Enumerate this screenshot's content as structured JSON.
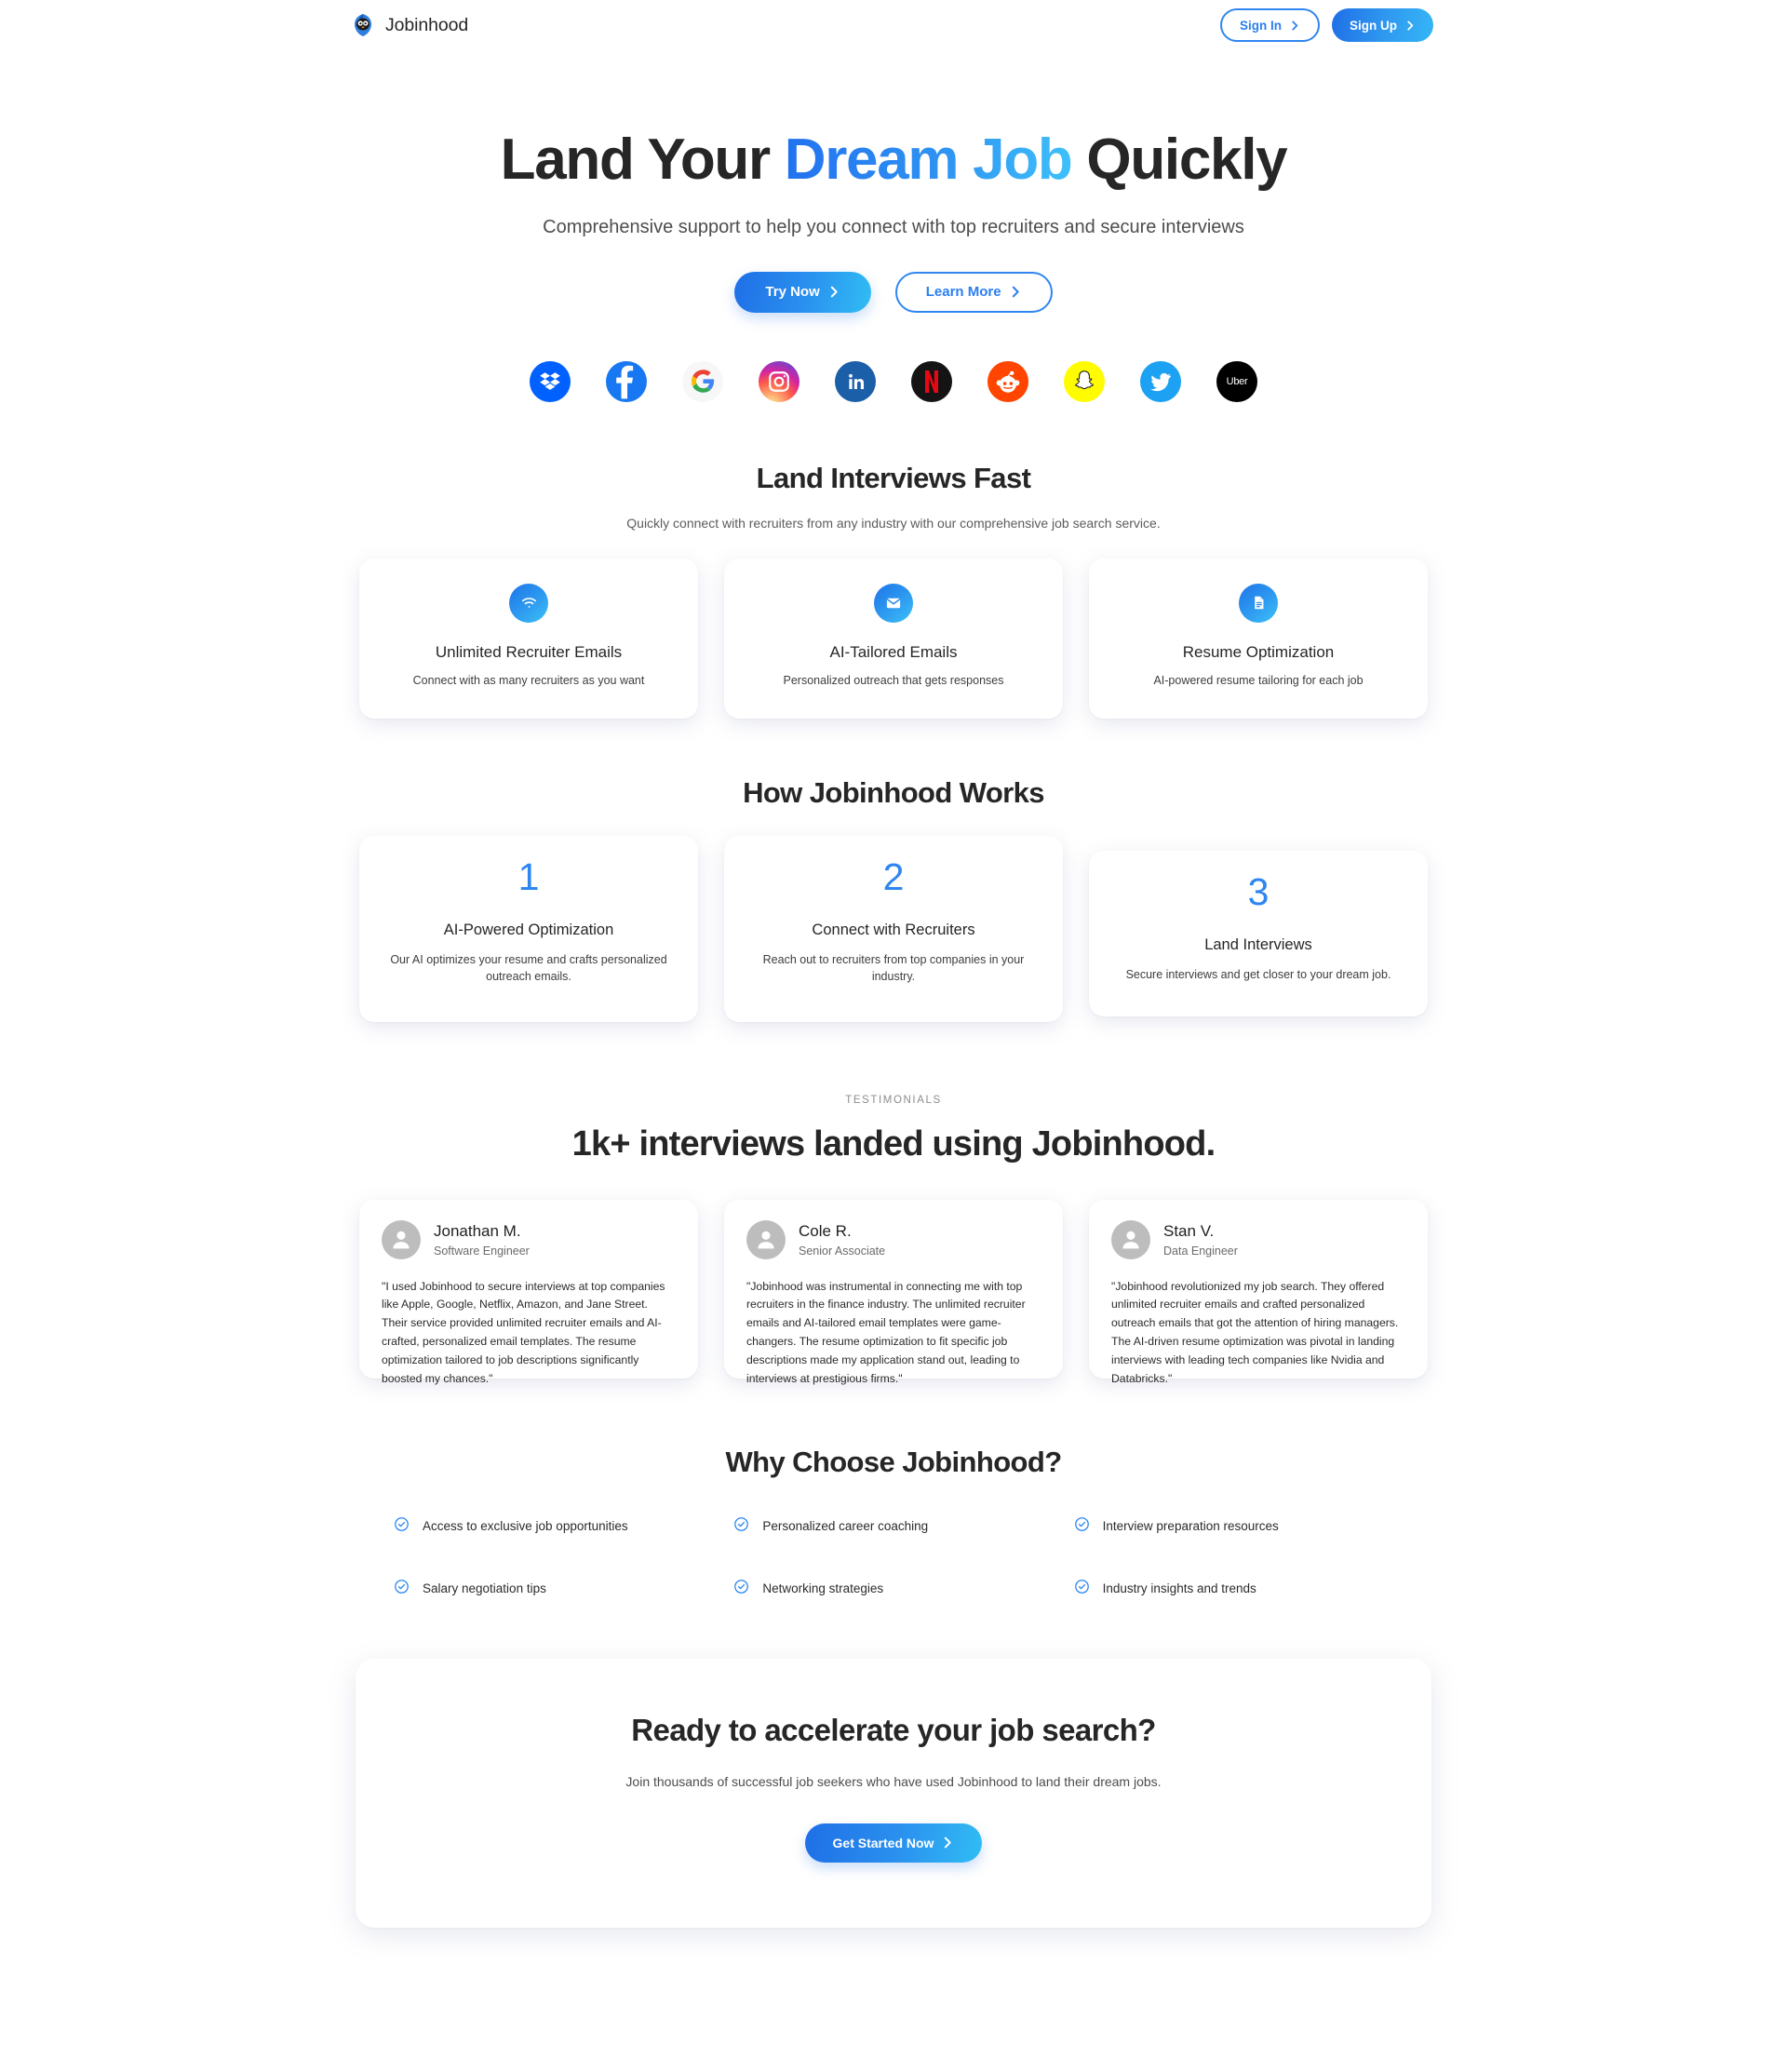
{
  "header": {
    "brand_name": "Jobinhood",
    "brand_logo_icon": "jobinhood-owl-logo",
    "sign_in_label": "Sign In",
    "sign_up_label": "Sign Up"
  },
  "hero": {
    "title_part1": "Land Your ",
    "title_highlight": "Dream Job",
    "title_part2": " Quickly",
    "subtitle": "Comprehensive support to help you connect with top recruiters and secure interviews",
    "primary_cta": "Try Now",
    "secondary_cta": "Learn More"
  },
  "logos": [
    {
      "name": "dropbox",
      "label": "Dropbox",
      "bg": "#0061FF"
    },
    {
      "name": "facebook",
      "label": "Facebook",
      "bg": "#1877F2"
    },
    {
      "name": "google",
      "label": "Google",
      "bg": "#F7F7F7"
    },
    {
      "name": "instagram",
      "label": "Instagram",
      "bg": "#E1306C"
    },
    {
      "name": "linkedin",
      "label": "LinkedIn",
      "bg": "#1A5FA8"
    },
    {
      "name": "netflix",
      "label": "Netflix",
      "bg": "#141414"
    },
    {
      "name": "reddit",
      "label": "Reddit",
      "bg": "#FF4500"
    },
    {
      "name": "snapchat",
      "label": "Snapchat",
      "bg": "#FFFC00"
    },
    {
      "name": "twitter",
      "label": "Twitter",
      "bg": "#1DA1F2"
    },
    {
      "name": "uber",
      "label": "Uber",
      "bg": "#000000"
    }
  ],
  "features_section": {
    "title": "Land Interviews Fast",
    "subtitle": "Quickly connect with recruiters from any industry with our comprehensive job search service.",
    "cards": [
      {
        "icon": "wifi-signal-icon",
        "title": "Unlimited Recruiter Emails",
        "desc": "Connect with as many recruiters as you want"
      },
      {
        "icon": "envelope-icon",
        "title": "AI-Tailored Emails",
        "desc": "Personalized outreach that gets responses"
      },
      {
        "icon": "document-icon",
        "title": "Resume Optimization",
        "desc": "AI-powered resume tailoring for each job"
      }
    ]
  },
  "how_section": {
    "title": "How Jobinhood Works",
    "steps": [
      {
        "number": "1",
        "title": "AI-Powered Optimization",
        "desc": "Our AI optimizes your resume and crafts personalized outreach emails."
      },
      {
        "number": "2",
        "title": "Connect with Recruiters",
        "desc": "Reach out to recruiters from top companies in your industry."
      },
      {
        "number": "3",
        "title": "Land Interviews",
        "desc": "Secure interviews and get closer to your dream job."
      }
    ]
  },
  "testimonials_section": {
    "eyebrow": "TESTIMONIALS",
    "title": "1k+ interviews landed using Jobinhood.",
    "items": [
      {
        "name": "Jonathan M.",
        "role": "Software Engineer",
        "quote": "\"I used Jobinhood to secure interviews at top companies like Apple, Google, Netflix, Amazon, and Jane Street. Their service provided unlimited recruiter emails and AI-crafted, personalized email templates. The resume optimization tailored to job descriptions significantly boosted my chances.\""
      },
      {
        "name": "Cole R.",
        "role": "Senior Associate",
        "quote": "\"Jobinhood was instrumental in connecting me with top recruiters in the finance industry. The unlimited recruiter emails and AI-tailored email templates were game-changers. The resume optimization to fit specific job descriptions made my application stand out, leading to interviews at prestigious firms.\""
      },
      {
        "name": "Stan V.",
        "role": "Data Engineer",
        "quote": "\"Jobinhood revolutionized my job search. They offered unlimited recruiter emails and crafted personalized outreach emails that got the attention of hiring managers. The AI-driven resume optimization was pivotal in landing interviews with leading tech companies like Nvidia and Databricks.\""
      }
    ]
  },
  "why_section": {
    "title": "Why Choose Jobinhood?",
    "items": [
      "Access to exclusive job opportunities",
      "Personalized career coaching",
      "Interview preparation resources",
      "Salary negotiation tips",
      "Networking strategies",
      "Industry insights and trends"
    ]
  },
  "final_cta": {
    "title": "Ready to accelerate your job search?",
    "subtitle": "Join thousands of successful job seekers who have used Jobinhood to land their dream jobs.",
    "button_label": "Get Started Now"
  },
  "colors": {
    "accent_blue": "#2e86f0",
    "accent_cyan": "#36b6f7",
    "text_dark": "#262626",
    "text_muted": "#5c5c5c"
  }
}
